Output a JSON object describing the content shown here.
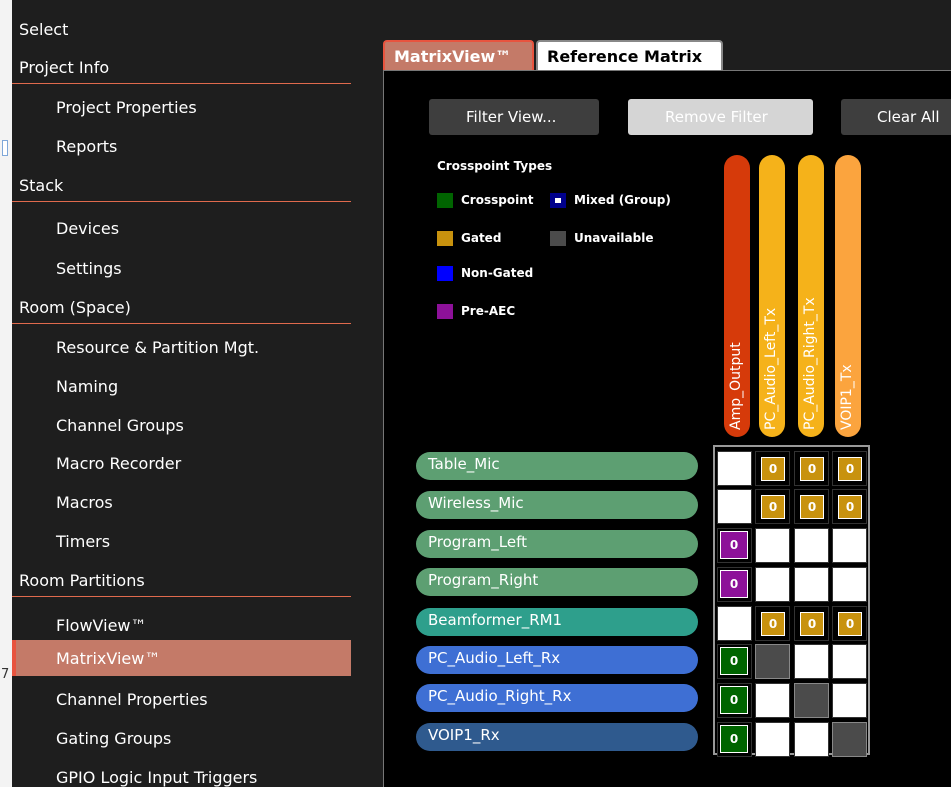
{
  "sidebar": {
    "items": [
      {
        "label": "Select",
        "kind": "cat",
        "line": false
      },
      {
        "label": "Project Info",
        "kind": "cat",
        "line": true
      },
      {
        "label": "Project Properties",
        "kind": "item"
      },
      {
        "label": "Reports",
        "kind": "item"
      },
      {
        "label": "Stack",
        "kind": "cat",
        "line": true
      },
      {
        "label": "Devices",
        "kind": "item"
      },
      {
        "label": "Settings",
        "kind": "item"
      },
      {
        "label": "Room (Space)",
        "kind": "cat",
        "line": true
      },
      {
        "label": "Resource & Partition Mgt.",
        "kind": "item"
      },
      {
        "label": "Naming",
        "kind": "item"
      },
      {
        "label": "Channel Groups",
        "kind": "item"
      },
      {
        "label": "Macro Recorder",
        "kind": "item"
      },
      {
        "label": "Macros",
        "kind": "item"
      },
      {
        "label": "Timers",
        "kind": "item"
      },
      {
        "label": "Room Partitions",
        "kind": "cat",
        "line": true
      },
      {
        "label": "FlowView™",
        "kind": "item"
      },
      {
        "label": "MatrixView™",
        "kind": "item",
        "active": true
      },
      {
        "label": "Channel Properties",
        "kind": "item"
      },
      {
        "label": "Gating Groups",
        "kind": "item"
      },
      {
        "label": "GPIO Logic Input Triggers",
        "kind": "item"
      }
    ]
  },
  "left_edge": {
    "text": "7"
  },
  "tabs": [
    {
      "label": "MatrixView™",
      "active": true
    },
    {
      "label": "Reference Matrix",
      "active": false
    }
  ],
  "toolbar": {
    "filter_label": "Filter View...",
    "remove_filter_label": "Remove Filter",
    "clear_label": "Clear All"
  },
  "legend": {
    "title": "Crosspoint Types",
    "items": [
      {
        "label": "Crosspoint",
        "color": "#006400"
      },
      {
        "label": "Mixed (Group)",
        "color": "#00008b"
      },
      {
        "label": "Gated",
        "color": "#c8920e"
      },
      {
        "label": "Unavailable",
        "color": "#4b4b4b"
      },
      {
        "label": "Non-Gated",
        "color": "#0000ff"
      },
      {
        "label": "Pre-AEC",
        "color": "#8d1199"
      }
    ]
  },
  "columns": [
    {
      "label": "Amp_Output",
      "color": "#d63a0a"
    },
    {
      "label": "PC_Audio_Left_Tx",
      "color": "#f5b21a"
    },
    {
      "label": "PC_Audio_Right_Tx",
      "color": "#f5b21a"
    },
    {
      "label": "VOIP1_Tx",
      "color": "#fba43e"
    }
  ],
  "rows": [
    {
      "label": "Table_Mic",
      "color": "#5d9f72",
      "cells": [
        "white",
        "gated",
        "gated",
        "gated"
      ]
    },
    {
      "label": "Wireless_Mic",
      "color": "#5d9f72",
      "cells": [
        "white",
        "gated",
        "gated",
        "gated"
      ]
    },
    {
      "label": "Program_Left",
      "color": "#5d9f72",
      "cells": [
        "pre",
        "white",
        "white",
        "white"
      ]
    },
    {
      "label": "Program_Right",
      "color": "#5d9f72",
      "cells": [
        "pre",
        "white",
        "white",
        "white"
      ]
    },
    {
      "label": "Beamformer_RM1",
      "color": "#2e9f8c",
      "cells": [
        "white",
        "gated",
        "gated",
        "gated"
      ]
    },
    {
      "label": "PC_Audio_Left_Rx",
      "color": "#3e6fd4",
      "cells": [
        "xp",
        "unav",
        "white",
        "white"
      ]
    },
    {
      "label": "PC_Audio_Right_Rx",
      "color": "#3e6fd4",
      "cells": [
        "xp",
        "white",
        "unav",
        "white"
      ]
    },
    {
      "label": "VOIP1_Rx",
      "color": "#2f5a8e",
      "cells": [
        "xp",
        "white",
        "white",
        "unav"
      ]
    }
  ],
  "cell_value": "0"
}
